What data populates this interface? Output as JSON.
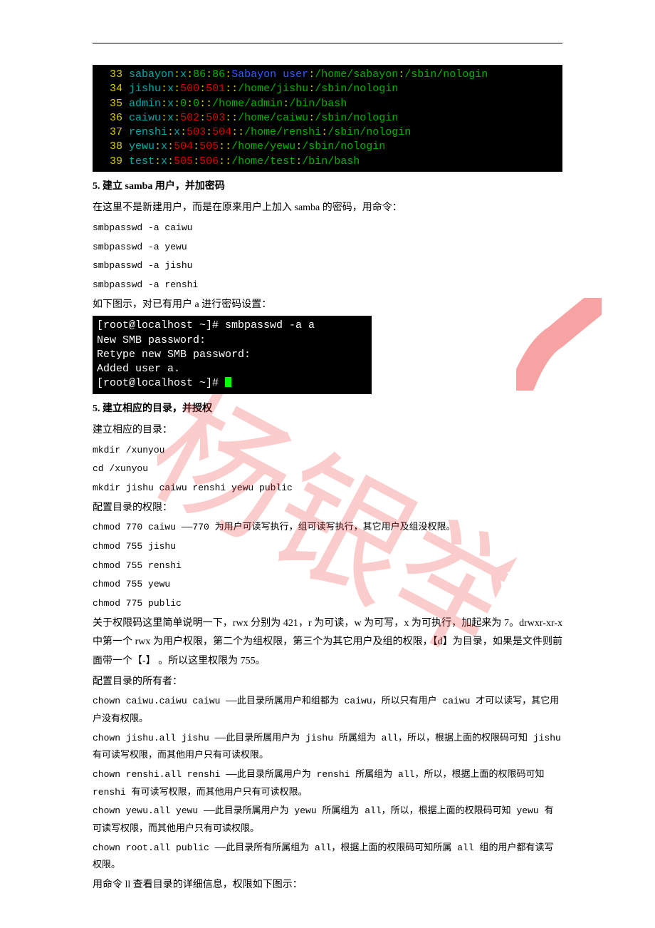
{
  "terminal1": {
    "lines": [
      {
        "num": "33",
        "user": "sabayon",
        "uid": "86",
        "gid": "86",
        "desc": "Sabayon user",
        "home": "/home/sabayon",
        "shell": "/sbin/nologin",
        "uidcolor": "gr",
        "gidcolor": "gr",
        "desccolor": "bl"
      },
      {
        "num": "34",
        "user": "jishu",
        "uid": "500",
        "gid": "501",
        "desc": "",
        "home": "/home/jishu",
        "shell": "/sbin/nologin",
        "uidcolor": "rd",
        "gidcolor": "rd",
        "desccolor": "wh"
      },
      {
        "num": "35",
        "user": "admin",
        "uid": "0",
        "gid": "0",
        "desc": "",
        "home": "/home/admin",
        "shell": "/bin/bash",
        "uidcolor": "gr",
        "gidcolor": "gr",
        "desccolor": "wh"
      },
      {
        "num": "36",
        "user": "caiwu",
        "uid": "502",
        "gid": "503",
        "desc": "",
        "home": "/home/caiwu",
        "shell": "/sbin/nologin",
        "uidcolor": "rd",
        "gidcolor": "rd",
        "desccolor": "wh"
      },
      {
        "num": "37",
        "user": "renshi",
        "uid": "503",
        "gid": "504",
        "desc": "",
        "home": "/home/renshi",
        "shell": "/sbin/nologin",
        "uidcolor": "rd",
        "gidcolor": "rd",
        "desccolor": "wh"
      },
      {
        "num": "38",
        "user": "yewu",
        "uid": "504",
        "gid": "505",
        "desc": "",
        "home": "/home/yewu",
        "shell": "/sbin/nologin",
        "uidcolor": "rd",
        "gidcolor": "rd",
        "desccolor": "wh"
      },
      {
        "num": "39",
        "user": "test",
        "uid": "505",
        "gid": "506",
        "desc": "",
        "home": "/home/test",
        "shell": "/bin/bash",
        "uidcolor": "rd",
        "gidcolor": "rd",
        "desccolor": "wh"
      }
    ]
  },
  "section1": {
    "title": "5. 建立 samba 用户，并加密码",
    "intro": "在这里不是新建用户，而是在原来用户上加入 samba 的密码，用命令：",
    "cmds": [
      "smbpasswd -a caiwu",
      "smbpasswd -a yewu",
      "smbpasswd -a jishu",
      "smbpasswd -a renshi"
    ],
    "note": "如下图示，对已有用户 a 进行密码设置："
  },
  "terminal2": {
    "l1a": "[root@localhost ~]# ",
    "l1b": "smbpasswd -a a",
    "l2": "New SMB password:",
    "l3": "Retype new SMB password:",
    "l4": "Added user a.",
    "l5": "[root@localhost ~]# "
  },
  "section2": {
    "title": "5. 建立相应的目录，并授权",
    "p1": "建立相应的目录：",
    "cmdsA": [
      "mkdir /xunyou",
      "cd /xunyou",
      "mkdir jishu caiwu renshi yewu public"
    ],
    "p2": "配置目录的权限：",
    "chmod1": "chmod 770 caiwu  ——770 为用户可读写执行，组可读写执行，其它用户及组没权限。",
    "cmdsB": [
      "chmod 755 jishu",
      "chmod 755 renshi",
      "chmod 755 yewu",
      "chmod 775 public"
    ],
    "explain": "关于权限码这里简单说明一下，rwx 分别为 421，r 为可读，w 为可写，x 为可执行，加起来为 7。drwxr-xr-x 中第一个 rwx 为用户权限，第二个为组权限，第三个为其它用户及组的权限，【d】为目录，如果是文件则前面带一个【-】 。所以这里权限为 755。",
    "p3": "配置目录的所有者：",
    "chown1": "chown caiwu.caiwu caiwu  ——此目录所属用户和组都为 caiwu，所以只有用户 caiwu 才可以读写，其它用户没有权限。",
    "chown2": "chown jishu.all jishu  ——此目录所属用户为 jishu 所属组为 all，所以，根据上面的权限码可知 jishu 有可读写权限，而其他用户只有可读权限。",
    "chown3": "chown renshi.all renshi  ——此目录所属用户为 renshi 所属组为 all，所以，根据上面的权限码可知 renshi 有可读写权限，而其他用户只有可读权限。",
    "chown4": "chown yewu.all yewu  ——此目录所属用户为 yewu 所属组为 all，所以，根据上面的权限码可知 yewu 有可读写权限，而其他用户只有可读权限。",
    "chown5": "chown root.all public  ——此目录所有所属组为 all，根据上面的权限码可知所属 all 组的用户都有读写权限。",
    "last": "用命令 ll 查看目录的详细信息，权限如下图示："
  },
  "watermark_text": "杨银举"
}
